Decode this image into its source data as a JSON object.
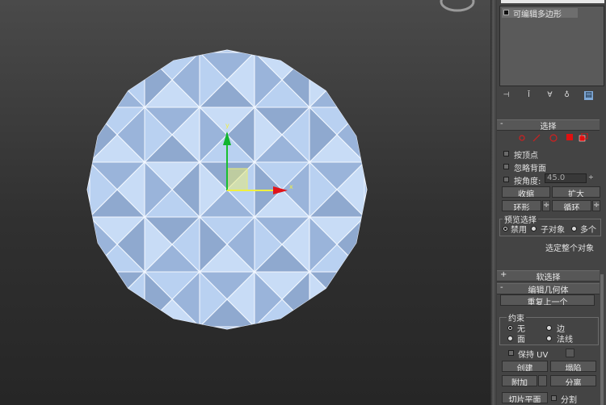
{
  "modifier_stack": {
    "item": "可编辑多边形"
  },
  "selection": {
    "title": "选择",
    "by_vertex": "按顶点",
    "ignore_backfacing": "忽略背面",
    "by_angle": "按角度:",
    "angle_value": "45.0",
    "shrink": "收缩",
    "grow": "扩大",
    "ring": "环形",
    "loop": "循环",
    "preview_group": "预览选择",
    "preview_off": "禁用",
    "preview_subobject": "子对象",
    "preview_multi": "多个",
    "status": "选定整个对象"
  },
  "soft_selection": {
    "title": "软选择"
  },
  "edit_geometry": {
    "title": "编辑几何体",
    "repeat_last": "重复上一个",
    "constraint_group": "约束",
    "none": "无",
    "edge": "边",
    "face": "面",
    "normal": "法线",
    "preserve_uv": "保持 UV",
    "create": "创建",
    "collapse": "塌陷",
    "attach": "附加",
    "detach": "分离",
    "slice_plane": "切片平面",
    "split": "分割"
  },
  "colors": {
    "panel_bg": "#444444",
    "mesh_fill": "#a9c4ea",
    "gizmo_x": "#e0141a",
    "gizmo_y": "#12b430",
    "gizmo_plane": "#e6ea7a"
  },
  "icons": [
    "pin-icon",
    "show-end-result-icon",
    "make-unique-icon",
    "remove-modifier-icon",
    "configure-sets-icon"
  ]
}
